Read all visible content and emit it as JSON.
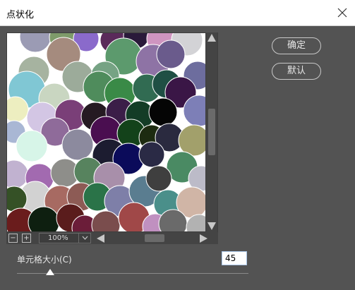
{
  "window": {
    "title": "点状化",
    "close_icon": "close-icon"
  },
  "buttons": {
    "ok_label": "确定",
    "default_label": "默认"
  },
  "preview": {
    "zoom_out_symbol": "−",
    "zoom_in_symbol": "+",
    "zoom_value": "100%"
  },
  "parameter": {
    "cell_size_label": "单元格大小(C)",
    "cell_size_value": "45",
    "cell_size_min": 3,
    "cell_size_max": 300
  },
  "colors": {
    "background": "#535353",
    "accent_input_border": "#a9c6e8"
  }
}
